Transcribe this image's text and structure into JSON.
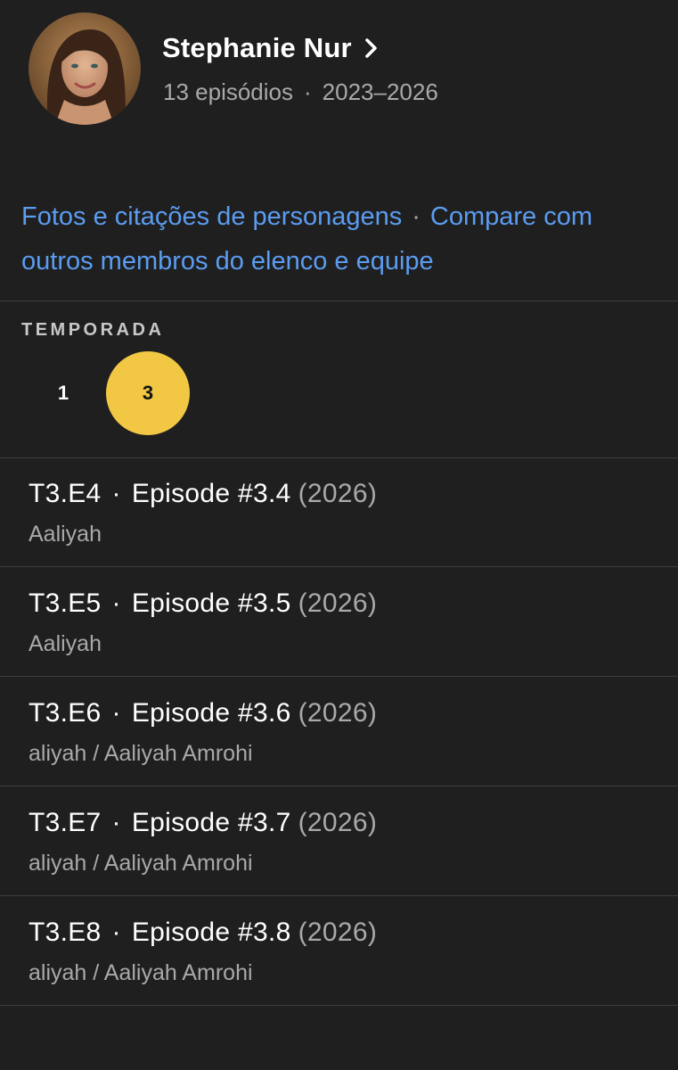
{
  "actor": {
    "name": "Stephanie Nur",
    "episode_count": "13 episódios",
    "years": "2023–2026",
    "meta_separator": "·"
  },
  "links": {
    "photos_quotes": "Fotos e citações de personagens",
    "separator": "·",
    "compare": "Compare com outros membros do elenco e equipe"
  },
  "season_selector": {
    "label": "TEMPORADA",
    "seasons": [
      "1",
      "3"
    ],
    "selected": "3",
    "active_color": "#f1c744"
  },
  "episodes": [
    {
      "code": "T3.E4",
      "separator": "·",
      "title": "Episode #3.4",
      "year": "(2026)",
      "role": "Aaliyah"
    },
    {
      "code": "T3.E5",
      "separator": "·",
      "title": "Episode #3.5",
      "year": "(2026)",
      "role": "Aaliyah"
    },
    {
      "code": "T3.E6",
      "separator": "·",
      "title": "Episode #3.6",
      "year": "(2026)",
      "role": "aliyah / Aaliyah Amrohi"
    },
    {
      "code": "T3.E7",
      "separator": "·",
      "title": "Episode #3.7",
      "year": "(2026)",
      "role": "aliyah / Aaliyah Amrohi"
    },
    {
      "code": "T3.E8",
      "separator": "·",
      "title": "Episode #3.8",
      "year": "(2026)",
      "role": "aliyah / Aaliyah Amrohi"
    }
  ],
  "icons": {
    "chevron": "chevron-right-icon"
  },
  "colors": {
    "background": "#1f1f1f",
    "link": "#5b9cf0",
    "muted_text": "#a9a9a9",
    "divider": "#3d3d3d"
  }
}
